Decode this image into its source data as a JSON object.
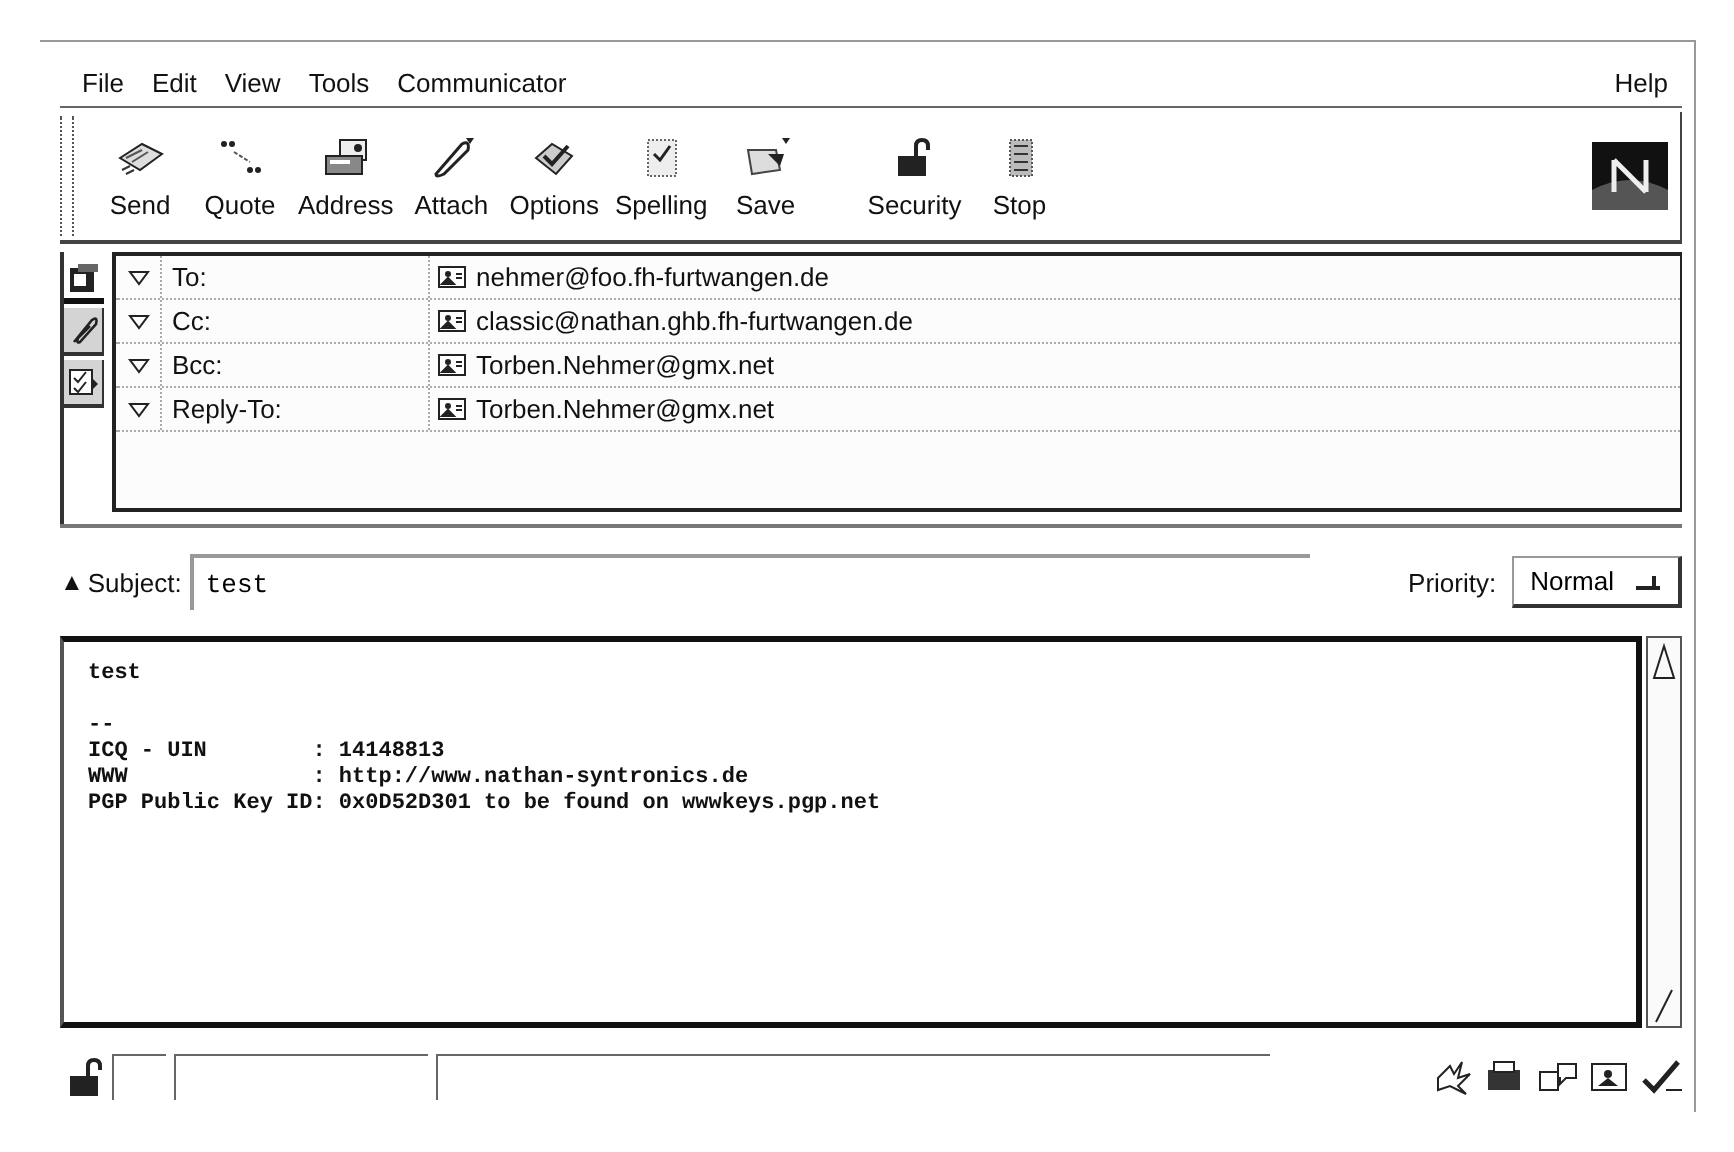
{
  "menu": {
    "left": [
      "File",
      "Edit",
      "View",
      "Tools",
      "Communicator"
    ],
    "right": "Help"
  },
  "toolbar": {
    "groups": [
      [
        {
          "label": "Send"
        },
        {
          "label": "Quote"
        },
        {
          "label": "Address"
        },
        {
          "label": "Attach"
        },
        {
          "label": "Options"
        },
        {
          "label": "Spelling"
        },
        {
          "label": "Save"
        }
      ],
      [
        {
          "label": "Security"
        },
        {
          "label": "Stop"
        }
      ]
    ]
  },
  "side_tabs": [
    {
      "kind": "addresses",
      "selected": true
    },
    {
      "kind": "attachments",
      "selected": false
    },
    {
      "kind": "options",
      "selected": false
    }
  ],
  "recipients": [
    {
      "field": "To:",
      "address": "nehmer@foo.fh-furtwangen.de"
    },
    {
      "field": "Cc:",
      "address": "classic@nathan.ghb.fh-furtwangen.de"
    },
    {
      "field": "Bcc:",
      "address": "Torben.Nehmer@gmx.net"
    },
    {
      "field": "Reply-To:",
      "address": "Torben.Nehmer@gmx.net"
    }
  ],
  "subject": {
    "toggle": "▲",
    "label": "Subject:",
    "value": "test"
  },
  "priority": {
    "label": "Priority:",
    "value": "Normal"
  },
  "body": {
    "paragraphs": [
      [
        "test"
      ],
      [
        "--",
        "ICQ - UIN        : 14148813",
        "WWW              : http://www.nathan-syntronics.de",
        "PGP Public Key ID: 0x0D52D301 to be found on wwwkeys.pgp.net"
      ]
    ]
  }
}
